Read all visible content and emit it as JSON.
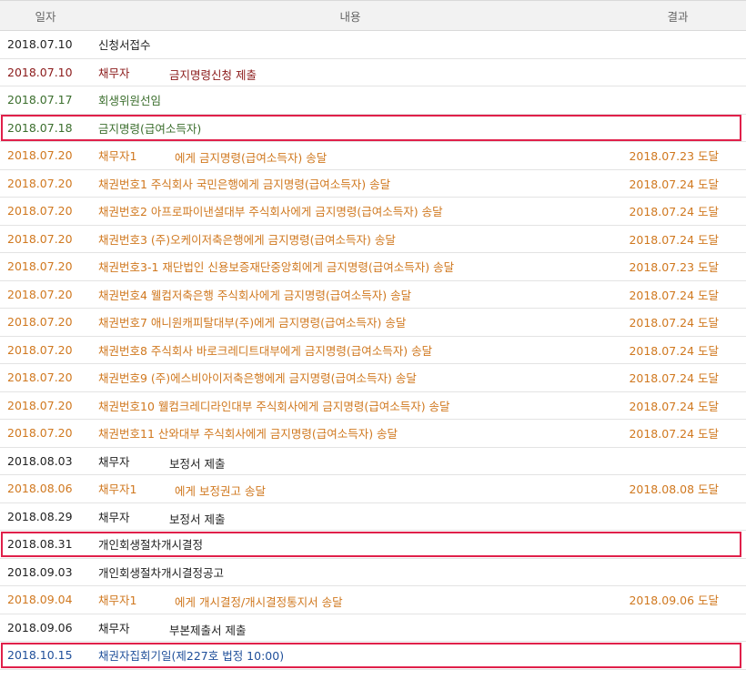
{
  "header": {
    "date": "일자",
    "content": "내용",
    "result": "결과"
  },
  "rows": [
    {
      "date": "2018.07.10",
      "a": "신청서접수",
      "b": "",
      "result": "",
      "color": "black",
      "hl": false
    },
    {
      "date": "2018.07.10",
      "a": "채무자",
      "b": "금지명령신청 제출",
      "result": "",
      "color": "maroon",
      "hl": false
    },
    {
      "date": "2018.07.17",
      "a": "회생위원선임",
      "b": "",
      "result": "",
      "color": "green",
      "hl": false
    },
    {
      "date": "2018.07.18",
      "a": "금지명령(급여소득자)",
      "b": "",
      "result": "",
      "color": "green",
      "hl": true
    },
    {
      "date": "2018.07.20",
      "a": "채무자1",
      "b": "에게 금지명령(급여소득자) 송달",
      "result": "2018.07.23 도달",
      "color": "orange",
      "hl": false
    },
    {
      "date": "2018.07.20",
      "a": "채권번호1 주식회사 국민은행에게 금지명령(급여소득자) 송달",
      "b": "",
      "result": "2018.07.24 도달",
      "color": "orange",
      "hl": false
    },
    {
      "date": "2018.07.20",
      "a": "채권번호2 아프로파이낸셜대부 주식회사에게 금지명령(급여소득자) 송달",
      "b": "",
      "result": "2018.07.24 도달",
      "color": "orange",
      "hl": false
    },
    {
      "date": "2018.07.20",
      "a": "채권번호3 (주)오케이저축은행에게 금지명령(급여소득자) 송달",
      "b": "",
      "result": "2018.07.24 도달",
      "color": "orange",
      "hl": false
    },
    {
      "date": "2018.07.20",
      "a": "채권번호3-1 재단법인 신용보증재단중앙회에게 금지명령(급여소득자) 송달",
      "b": "",
      "result": "2018.07.23 도달",
      "color": "orange",
      "hl": false
    },
    {
      "date": "2018.07.20",
      "a": "채권번호4 웰컴저축은행 주식회사에게 금지명령(급여소득자) 송달",
      "b": "",
      "result": "2018.07.24 도달",
      "color": "orange",
      "hl": false
    },
    {
      "date": "2018.07.20",
      "a": "채권번호7 애니원캐피탈대부(주)에게 금지명령(급여소득자) 송달",
      "b": "",
      "result": "2018.07.24 도달",
      "color": "orange",
      "hl": false
    },
    {
      "date": "2018.07.20",
      "a": "채권번호8 주식회사 바로크레디트대부에게 금지명령(급여소득자) 송달",
      "b": "",
      "result": "2018.07.24 도달",
      "color": "orange",
      "hl": false
    },
    {
      "date": "2018.07.20",
      "a": "채권번호9 (주)에스비아이저축은행에게 금지명령(급여소득자) 송달",
      "b": "",
      "result": "2018.07.24 도달",
      "color": "orange",
      "hl": false
    },
    {
      "date": "2018.07.20",
      "a": "채권번호10 웰컴크레디라인대부 주식회사에게 금지명령(급여소득자) 송달",
      "b": "",
      "result": "2018.07.24 도달",
      "color": "orange",
      "hl": false
    },
    {
      "date": "2018.07.20",
      "a": "채권번호11 산와대부 주식회사에게 금지명령(급여소득자) 송달",
      "b": "",
      "result": "2018.07.24 도달",
      "color": "orange",
      "hl": false
    },
    {
      "date": "2018.08.03",
      "a": "채무자",
      "b": "보정서 제출",
      "result": "",
      "color": "black",
      "hl": false
    },
    {
      "date": "2018.08.06",
      "a": "채무자1",
      "b": "에게 보정권고 송달",
      "result": "2018.08.08 도달",
      "color": "orange",
      "hl": false
    },
    {
      "date": "2018.08.29",
      "a": "채무자",
      "b": "보정서 제출",
      "result": "",
      "color": "black",
      "hl": false
    },
    {
      "date": "2018.08.31",
      "a": "개인회생절차개시결정",
      "b": "",
      "result": "",
      "color": "black",
      "hl": true
    },
    {
      "date": "2018.09.03",
      "a": "개인회생절차개시결정공고",
      "b": "",
      "result": "",
      "color": "black",
      "hl": false
    },
    {
      "date": "2018.09.04",
      "a": "채무자1",
      "b": "에게 개시결정/개시결정통지서 송달",
      "result": "2018.09.06 도달",
      "color": "orange",
      "hl": false
    },
    {
      "date": "2018.09.06",
      "a": "채무자",
      "b": "부본제출서 제출",
      "result": "",
      "color": "black",
      "hl": false
    },
    {
      "date": "2018.10.15",
      "a": "채권자집회기일(제227호 법정 10:00)",
      "b": "",
      "result": "",
      "color": "blue",
      "hl": true
    }
  ]
}
